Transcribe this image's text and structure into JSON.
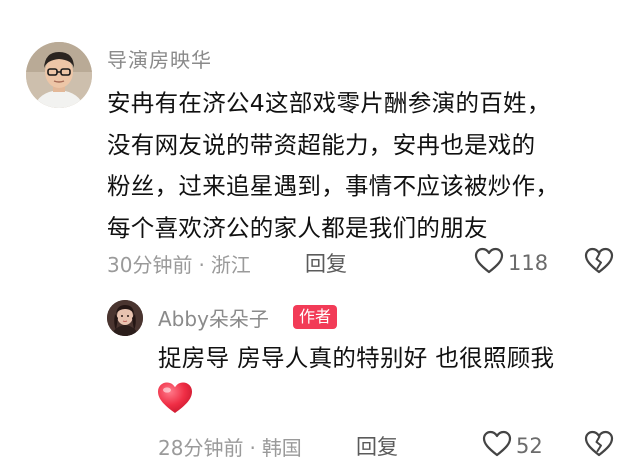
{
  "comment": {
    "username": "导演房映华",
    "avatar_icon": "director-avatar",
    "lines": [
      "安冉有在济公4这部戏零片酬参演的百姓，",
      "没有网友说的带资超能力，安冉也是戏的",
      "粉丝，过来追星遇到，事情不应该被炒作，",
      "每个喜欢济公的家人都是我们的朋友"
    ],
    "time": "30分钟前",
    "separator": "·",
    "location": "浙江",
    "reply_label": "回复",
    "like_count": "118",
    "like_icon": "heart-outline-icon",
    "dislike_icon": "broken-heart-icon"
  },
  "reply": {
    "username": "Abby朵朵子",
    "badge": "作者",
    "avatar_icon": "user-avatar",
    "text": "捉房导 房导人真的特别好 也很照顾我",
    "emoji_icon": "red-heart-emoji",
    "time": "28分钟前",
    "separator": "·",
    "location": "韩国",
    "reply_label": "回复",
    "like_count": "52",
    "like_icon": "heart-outline-icon",
    "dislike_icon": "broken-heart-icon"
  },
  "colors": {
    "badge": "#f23b57",
    "meta_text": "#9a9a9a",
    "body_text": "#111111",
    "heart_emoji": "#ef2e45"
  }
}
